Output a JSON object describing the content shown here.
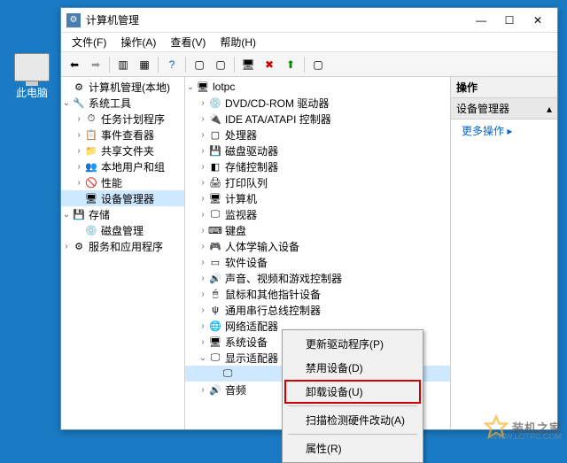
{
  "desktop": {
    "this_pc": "此电脑"
  },
  "window": {
    "title": "计算机管理"
  },
  "menu": {
    "file": "文件(F)",
    "action": "操作(A)",
    "view": "查看(V)",
    "help": "帮助(H)"
  },
  "left_tree": {
    "root": "计算机管理(本地)",
    "n1": "系统工具",
    "n1_1": "任务计划程序",
    "n1_2": "事件查看器",
    "n1_3": "共享文件夹",
    "n1_4": "本地用户和组",
    "n1_5": "性能",
    "n1_6": "设备管理器",
    "n2": "存储",
    "n2_1": "磁盘管理",
    "n3": "服务和应用程序"
  },
  "mid_tree": {
    "root": "lotpc",
    "d0": "DVD/CD-ROM 驱动器",
    "d1": "IDE ATA/ATAPI 控制器",
    "d2": "处理器",
    "d3": "磁盘驱动器",
    "d4": "存储控制器",
    "d5": "打印队列",
    "d6": "计算机",
    "d7": "监视器",
    "d8": "键盘",
    "d9": "人体学输入设备",
    "d10": "软件设备",
    "d11": "声音、视频和游戏控制器",
    "d12": "鼠标和其他指针设备",
    "d13": "通用串行总线控制器",
    "d14": "网络适配器",
    "d15": "系统设备",
    "d16": "显示适配器",
    "d17_partial": "音频"
  },
  "actions": {
    "header": "操作",
    "group": "设备管理器",
    "more": "更多操作"
  },
  "context": {
    "update": "更新驱动程序(P)",
    "disable": "禁用设备(D)",
    "uninstall": "卸载设备(U)",
    "scan": "扫描检测硬件改动(A)",
    "props": "属性(R)"
  },
  "watermark": {
    "text": "装机之家",
    "url": "WWW.LOTPC.COM"
  }
}
